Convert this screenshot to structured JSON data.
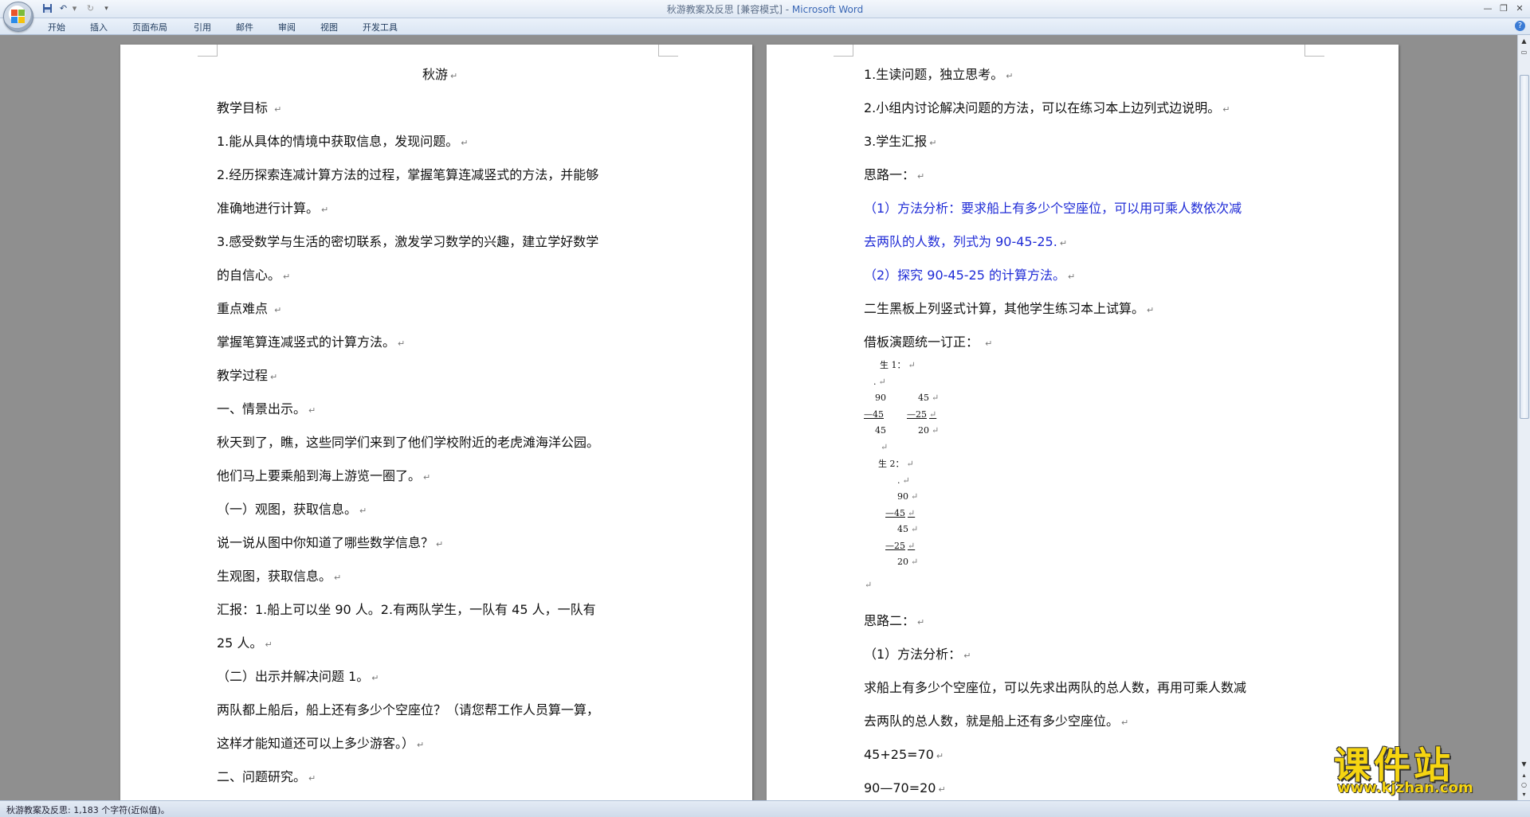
{
  "window": {
    "title": "秋游教案及反思 [兼容模式] - ",
    "app_name": "Microsoft Word",
    "minimize_icon": "minimize-icon",
    "restore_icon": "restore-icon",
    "close_icon": "close-icon"
  },
  "quick_access": {
    "icons": [
      "save-icon",
      "undo-icon",
      "redo-icon",
      "customize-icon"
    ]
  },
  "ribbon": {
    "tabs": [
      {
        "label": "开始"
      },
      {
        "label": "插入"
      },
      {
        "label": "页面布局"
      },
      {
        "label": "引用"
      },
      {
        "label": "邮件"
      },
      {
        "label": "审阅"
      },
      {
        "label": "视图"
      },
      {
        "label": "开发工具"
      }
    ],
    "help": "?"
  },
  "document": {
    "left_page": [
      {
        "text": "秋游"
      },
      {
        "text": "教学目标 "
      },
      {
        "text": "1.能从具体的情境中获取信息，发现问题。"
      },
      {
        "text": "2.经历探索连减计算方法的过程，掌握笔算连减竖式的方法，并能够"
      },
      {
        "text": "准确地进行计算。"
      },
      {
        "text": "3.感受数学与生活的密切联系，激发学习数学的兴趣，建立学好数学"
      },
      {
        "text": "的自信心。"
      },
      {
        "text": "重点难点 "
      },
      {
        "text": "掌握笔算连减竖式的计算方法。"
      },
      {
        "text": "教学过程"
      },
      {
        "text": "一、情景出示。"
      },
      {
        "text": "秋天到了，瞧，这些同学们来到了他们学校附近的老虎滩海洋公园。"
      },
      {
        "text": "他们马上要乘船到海上游览一圈了。"
      },
      {
        "text": "（一）观图，获取信息。"
      },
      {
        "text": "说一说从图中你知道了哪些数学信息？"
      },
      {
        "text": "生观图，获取信息。"
      },
      {
        "text": "汇报：1.船上可以坐 90 人。2.有两队学生，一队有 45 人，一队有"
      },
      {
        "text": "25 人。"
      },
      {
        "text": "（二）出示并解决问题 1。"
      },
      {
        "text": "两队都上船后，船上还有多少个空座位？（请您帮工作人员算一算，"
      },
      {
        "text": "这样才能知道还可以上多少游客。）"
      },
      {
        "text": "二、问题研究。"
      }
    ],
    "right_page": [
      {
        "text": "1.生读问题，独立思考。"
      },
      {
        "text": "2.小组内讨论解决问题的方法，可以在练习本上边列式边说明。"
      },
      {
        "text": "3.学生汇报"
      },
      {
        "text": "思路一："
      },
      {
        "text": "（1）方法分析：要求船上有多少个空座位，可以用可乘人数依次减"
      },
      {
        "text": "去两队的人数，列式为 90-45-25."
      },
      {
        "text": "（2）探究 90-45-25 的计算方法。"
      },
      {
        "text": "二生黑板上列竖式计算，其他学生练习本上试算。"
      },
      {
        "text": "借板演题统一订正：  "
      },
      {
        "text": "思路二："
      },
      {
        "text": "（1）方法分析："
      },
      {
        "text": "求船上有多少个空座位，可以先求出两队的总人数，再用可乘人数减"
      },
      {
        "text": "去两队的总人数，就是船上还有多少空座位。"
      },
      {
        "text": "45+25=70"
      },
      {
        "text": "90—70=20"
      }
    ],
    "calc": {
      "s1_label": "生 1：",
      "s1_dot": ".",
      "s1_a": "90",
      "s1_b": "45",
      "s1_c": "—45",
      "s1_d": "—25",
      "s1_e": "45",
      "s1_f": "20",
      "s2_label": "生 2：",
      "s2_dot": ".",
      "s2_a": "90",
      "s2_b": "—45",
      "s2_c": "45",
      "s2_d": "—25",
      "s2_e": "20"
    },
    "paragraph_mark": "↵"
  },
  "statusbar": {
    "text": "秋游教案及反思: 1,183 个字符(近似值)。"
  },
  "watermark": {
    "title": "课件站",
    "url": "www.kjzhan.com"
  },
  "colors": {
    "accent_text": "#1f2bd6",
    "ribbon": "#dbe6f3",
    "workspace": "#8f8f8f"
  }
}
